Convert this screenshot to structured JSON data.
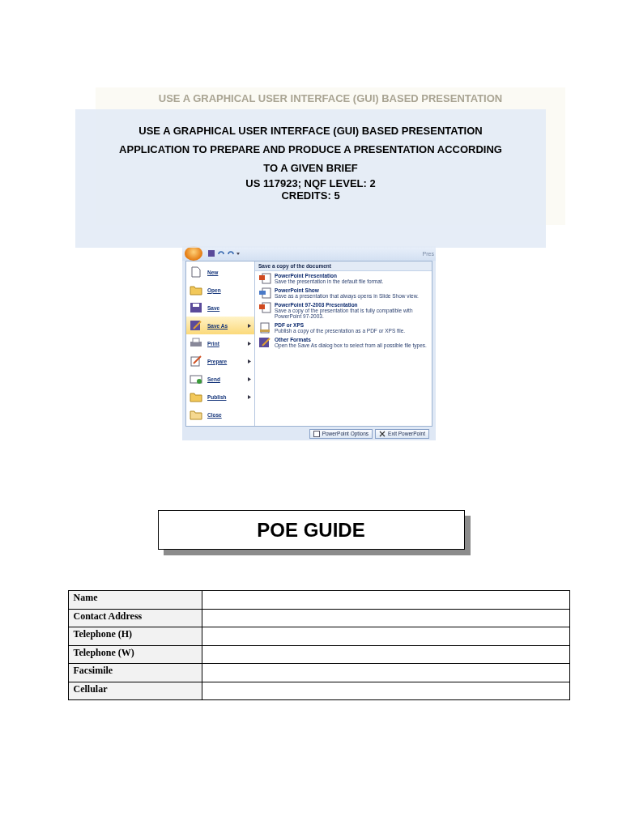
{
  "header": {
    "ghost_line": "USE A GRAPHICAL USER INTERFACE (GUI) BASED PRESENTATION",
    "title_lines": [
      "USE A GRAPHICAL USER INTERFACE (GUI) BASED PRESENTATION",
      "APPLICATION TO PREPARE AND PRODUCE A PRESENTATION ACCORDING",
      "TO A GIVEN BRIEF"
    ],
    "meta_lines": [
      "US 117923; NQF LEVEL: 2",
      "CREDITS: 5"
    ]
  },
  "screenshot": {
    "title_fragment": "Pres",
    "menu_items": [
      {
        "label": "New",
        "kind": "new",
        "submenu": false,
        "selected": false
      },
      {
        "label": "Open",
        "kind": "open",
        "submenu": false,
        "selected": false
      },
      {
        "label": "Save",
        "kind": "save",
        "submenu": false,
        "selected": false
      },
      {
        "label": "Save As",
        "kind": "saveas",
        "submenu": true,
        "selected": true
      },
      {
        "label": "Print",
        "kind": "print",
        "submenu": true,
        "selected": false
      },
      {
        "label": "Prepare",
        "kind": "prepare",
        "submenu": true,
        "selected": false
      },
      {
        "label": "Send",
        "kind": "send",
        "submenu": true,
        "selected": false
      },
      {
        "label": "Publish",
        "kind": "publish",
        "submenu": true,
        "selected": false
      },
      {
        "label": "Close",
        "kind": "close",
        "submenu": false,
        "selected": false
      }
    ],
    "panel_title": "Save a copy of the document",
    "options": [
      {
        "title": "PowerPoint Presentation",
        "description": "Save the presentation in the default file format.",
        "kind": "pptx"
      },
      {
        "title": "PowerPoint Show",
        "description": "Save as a presentation that always opens in Slide Show view.",
        "kind": "show"
      },
      {
        "title": "PowerPoint 97-2003 Presentation",
        "description": "Save a copy of the presentation that is fully compatible with PowerPoint 97-2003.",
        "kind": "ppt"
      },
      {
        "title": "PDF or XPS",
        "description": "Publish a copy of the presentation as a PDF or XPS file.",
        "kind": "pdf"
      },
      {
        "title": "Other Formats",
        "description": "Open the Save As dialog box to select from all possible file types.",
        "kind": "other"
      }
    ],
    "footer_buttons": [
      {
        "label": "PowerPoint Options",
        "kind": "options"
      },
      {
        "label": "Exit PowerPoint",
        "kind": "exit"
      }
    ]
  },
  "guide_title": "POE GUIDE",
  "form": {
    "rows": [
      {
        "label": "Name"
      },
      {
        "label": "Contact Address"
      },
      {
        "label": "Telephone (H)"
      },
      {
        "label": "Telephone (W)"
      },
      {
        "label": "Facsimile"
      },
      {
        "label": "Cellular"
      }
    ]
  }
}
